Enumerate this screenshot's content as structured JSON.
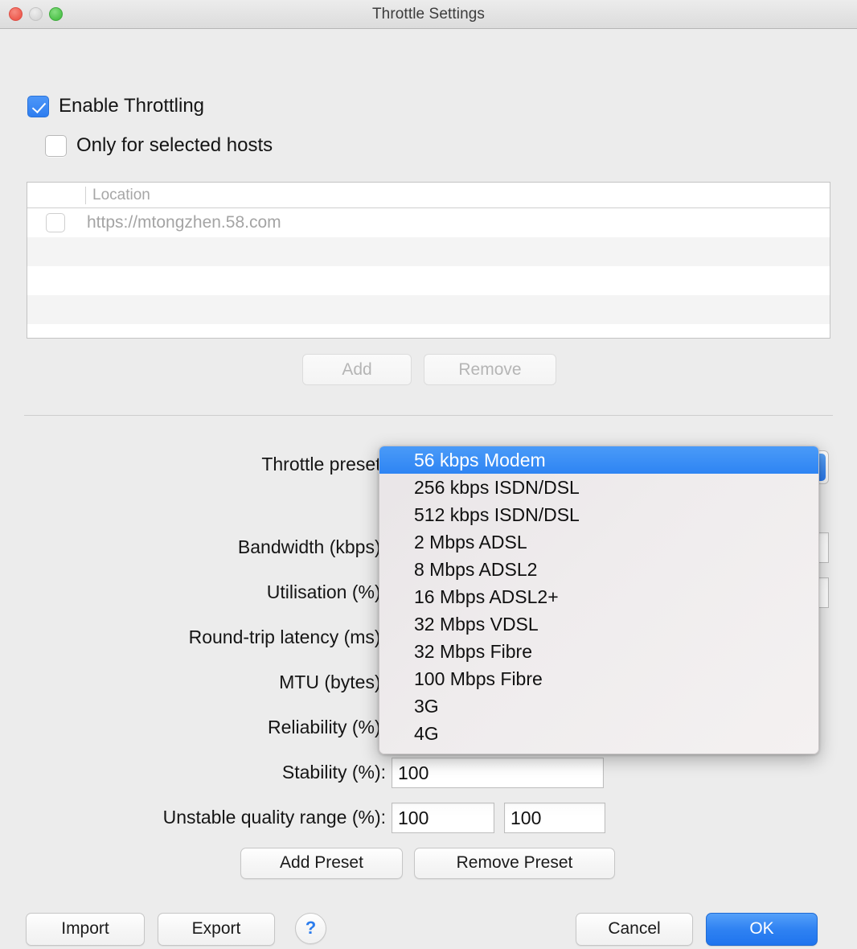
{
  "window": {
    "title": "Throttle Settings",
    "traffic_lights": {
      "close": "close-button",
      "minimize": "minimize-button",
      "maximize": "maximize-button"
    },
    "colors": {
      "close": "#ee5c50",
      "minimize": "#d6d6d6",
      "maximize": "#4fc24b",
      "accent": "#2e84f3",
      "background": "#ececec"
    }
  },
  "options": {
    "enable_throttling": {
      "label": "Enable Throttling",
      "checked": true
    },
    "only_selected_hosts": {
      "label": "Only for selected hosts",
      "checked": false
    }
  },
  "hosts_table": {
    "columns": [
      "",
      "Location"
    ],
    "rows": [
      {
        "checked": false,
        "location": "https://mtongzhen.58.com"
      }
    ],
    "empty_row_count": 4
  },
  "host_buttons": {
    "add": {
      "label": "Add",
      "disabled": true
    },
    "remove": {
      "label": "Remove",
      "disabled": true
    }
  },
  "form": {
    "throttle_preset": {
      "label": "Throttle preset:",
      "value": "56 kbps Modem"
    },
    "bandwidth": {
      "label": "Bandwidth (kbps):",
      "value": ""
    },
    "utilisation": {
      "label": "Utilisation (%):",
      "value": ""
    },
    "latency": {
      "label": "Round-trip latency (ms):",
      "value": ""
    },
    "mtu": {
      "label": "MTU (bytes):",
      "value": ""
    },
    "reliability": {
      "label": "Reliability (%):",
      "value": ""
    },
    "stability": {
      "label": "Stability (%):",
      "value": "100"
    },
    "unstable_range": {
      "label": "Unstable quality range (%):",
      "value_min": "100",
      "value_max": "100"
    }
  },
  "preset_menu": {
    "open": true,
    "selected_index": 0,
    "items": [
      "56 kbps Modem",
      "256 kbps ISDN/DSL",
      "512 kbps ISDN/DSL",
      "2 Mbps ADSL",
      "8 Mbps ADSL2",
      "16 Mbps ADSL2+",
      "32 Mbps VDSL",
      "32 Mbps Fibre",
      "100 Mbps Fibre",
      "3G",
      "4G"
    ]
  },
  "preset_buttons": {
    "add_preset": "Add Preset",
    "remove_preset": "Remove Preset"
  },
  "footer": {
    "import": "Import",
    "export": "Export",
    "help": "?",
    "cancel": "Cancel",
    "ok": "OK"
  }
}
